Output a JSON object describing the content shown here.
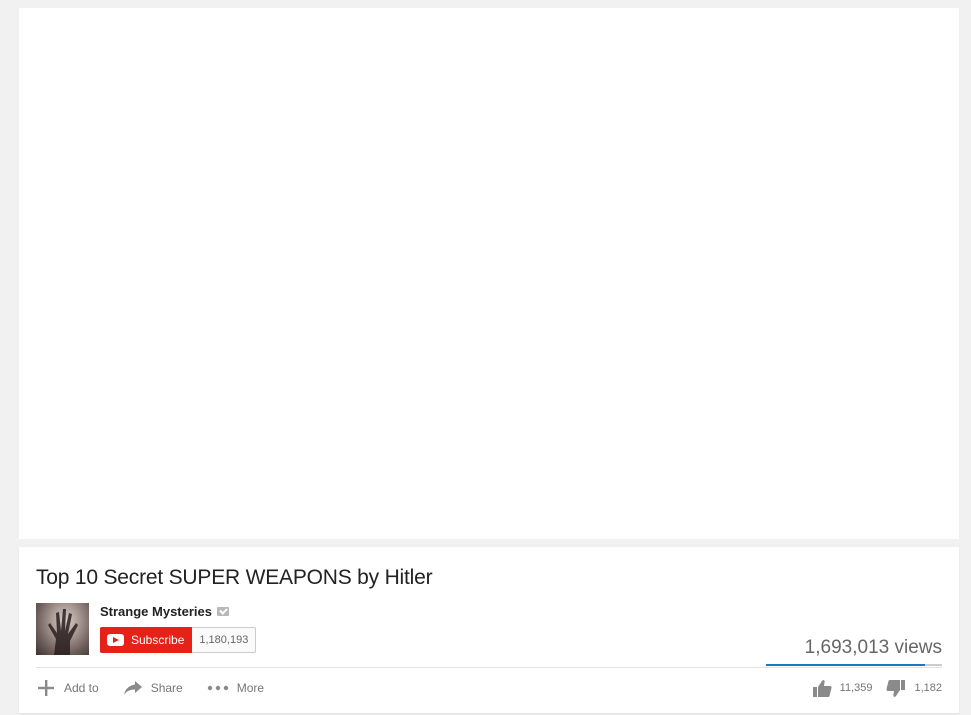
{
  "video": {
    "title": "Top 10 Secret SUPER WEAPONS by Hitler",
    "views": "1,693,013 views",
    "like_ratio": 0.906
  },
  "channel": {
    "name": "Strange Mysteries",
    "subscribe_label": "Subscribe",
    "subscriber_count": "1,180,193"
  },
  "actions": {
    "add_to": "Add to",
    "share": "Share",
    "more": "More"
  },
  "votes": {
    "likes": "11,359",
    "dislikes": "1,182"
  },
  "icons": {
    "verified": "verified-badge-icon",
    "add": "plus-icon",
    "share": "share-arrow-icon",
    "more": "ellipsis-icon",
    "like": "thumbs-up-icon",
    "dislike": "thumbs-down-icon",
    "subscribe": "youtube-play-icon"
  },
  "colors": {
    "subscribe_red": "#e62117",
    "like_bar_blue": "#167ac6"
  }
}
